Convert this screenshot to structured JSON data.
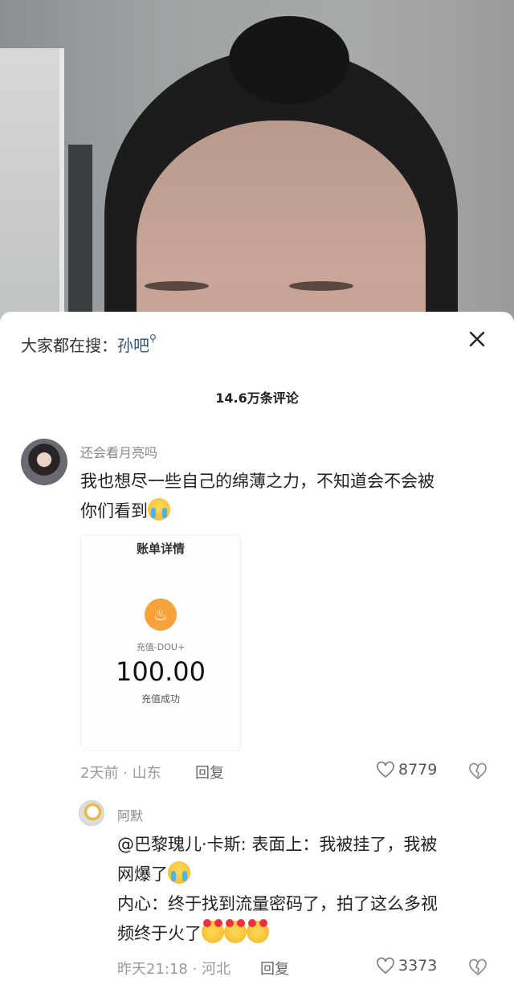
{
  "search": {
    "label": "大家都在搜：",
    "keyword": "孙吧"
  },
  "comments_count": "14.6万条评论",
  "comments": [
    {
      "user": "还会看月亮吗",
      "text_lines": [
        "我也想尽一些自己的绵薄之力，不知道会不会被",
        "你们看到"
      ],
      "emoji": "crying-face",
      "image": {
        "title": "账单详情",
        "subtitle": "充值-DOU+",
        "amount": "100.00",
        "status": "充值成功"
      },
      "time": "2天前",
      "location": "山东",
      "reply_label": "回复",
      "likes": "8779"
    },
    {
      "user": "阿默",
      "text_lines": [
        "@巴黎瑰儿·卡斯: 表面上：我被挂了，我被",
        "网爆了",
        "内心：终于找到流量密码了，拍了这么多视",
        "频终于火了"
      ],
      "time": "昨天21:18",
      "location": "河北",
      "reply_label": "回复",
      "likes": "3373"
    }
  ],
  "colors": {
    "keyword": "#2f5574",
    "coin": "#f7a23b"
  }
}
